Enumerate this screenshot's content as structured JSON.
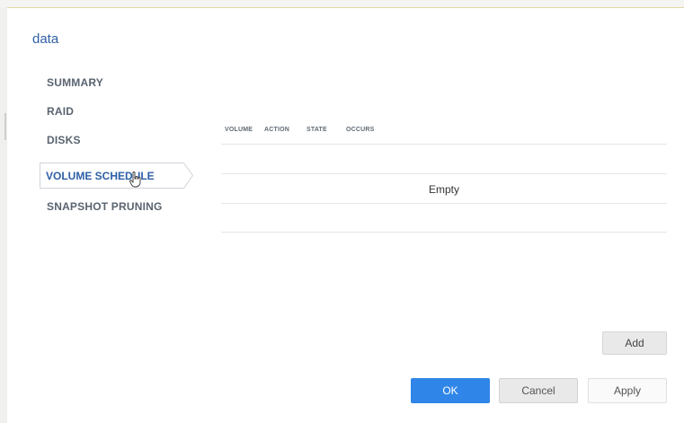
{
  "dialog": {
    "title": "data"
  },
  "nav": {
    "items": [
      {
        "label": "SUMMARY"
      },
      {
        "label": "RAID"
      },
      {
        "label": "DISKS"
      },
      {
        "label": "VOLUME SCHEDULE"
      },
      {
        "label": "SNAPSHOT PRUNING"
      }
    ],
    "selected_index": 3
  },
  "table": {
    "columns": [
      "VOLUME",
      "ACTION",
      "STATE",
      "OCCURS"
    ],
    "empty_text": "Empty"
  },
  "buttons": {
    "add": "Add",
    "ok": "OK",
    "cancel": "Cancel",
    "apply": "Apply"
  },
  "colors": {
    "accent": "#2f86e8",
    "title": "#2d5fa6"
  },
  "icons": [
    "hand-cursor-icon"
  ]
}
